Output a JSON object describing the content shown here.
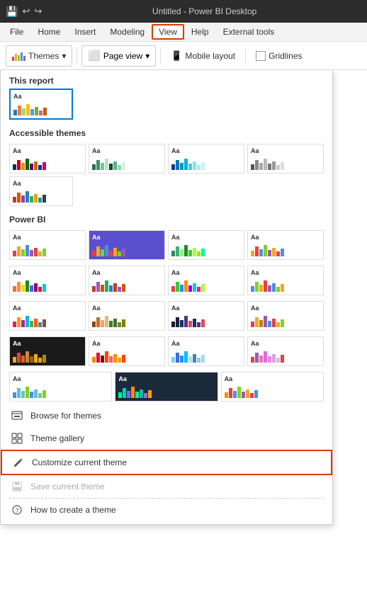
{
  "titleBar": {
    "title": "Untitled - Power BI Desktop"
  },
  "menuBar": {
    "items": [
      "File",
      "Home",
      "Insert",
      "Modeling",
      "View",
      "Help",
      "External tools"
    ],
    "activeItem": "View"
  },
  "ribbon": {
    "themesLabel": "Themes",
    "pageViewLabel": "Page view",
    "mobileLayoutLabel": "Mobile layout",
    "gridlinesLabel": "Gridlines",
    "chevron": "▾"
  },
  "dropdown": {
    "thisReportLabel": "This report",
    "accessibleThemesLabel": "Accessible themes",
    "powerBILabel": "Power BI",
    "browseForThemes": "Browse for themes",
    "themeGallery": "Theme gallery",
    "customizeCurrentTheme": "Customize current theme",
    "saveCurrentTheme": "Save current theme",
    "howToCreate": "How to create a theme"
  }
}
